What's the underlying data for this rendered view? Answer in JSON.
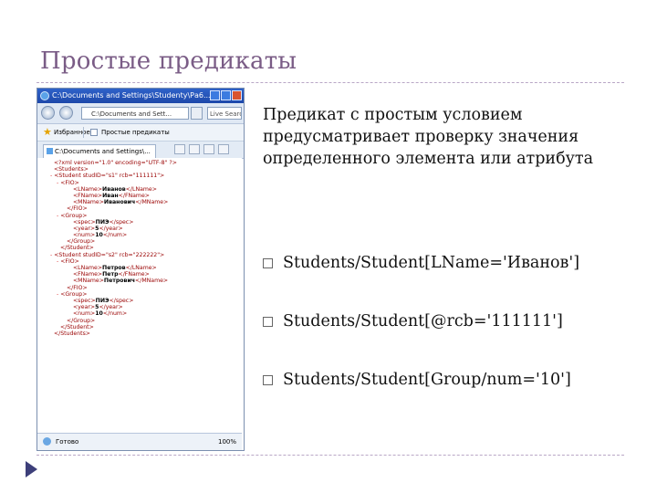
{
  "slide": {
    "title": "Простые предикаты",
    "description": "Предикат с простым условием предусматривает проверку значения определенного элемента или атрибута",
    "bullets": [
      "Students/Student[LName='Иванов']",
      "Students/Student[@rcb='111111']",
      "Students/Student[Group/num='10']"
    ]
  },
  "browser": {
    "window_title": "C:\\Documents and Settings\\Studenty\\Ра6...",
    "address": "C:\\Documents and Sett...",
    "search": "Live Search",
    "favorites_label": "Избранное",
    "favorites_page": "Простые предикаты",
    "tab_title": "C:\\Documents and Settings\\...",
    "status_text": "Готово",
    "zoom": "100%",
    "xml_lines": [
      {
        "indent": 0,
        "mark": "",
        "tag": "<?xml version=\"1.0\" encoding=\"UTF-8\" ?>",
        "text": ""
      },
      {
        "indent": 0,
        "mark": "",
        "tag": "<Students>",
        "text": ""
      },
      {
        "indent": 0,
        "mark": "- ",
        "tag": "<Student studID=\"s1\" rcb=\"111111\">",
        "text": ""
      },
      {
        "indent": 1,
        "mark": "- ",
        "tag": "<FIO>",
        "text": ""
      },
      {
        "indent": 3,
        "mark": "",
        "tag": "<LName>",
        "text": "Иванов",
        "close": "</LName>"
      },
      {
        "indent": 3,
        "mark": "",
        "tag": "<FName>",
        "text": "Иван",
        "close": "</FName>"
      },
      {
        "indent": 3,
        "mark": "",
        "tag": "<MName>",
        "text": "Иванович",
        "close": "</MName>"
      },
      {
        "indent": 2,
        "mark": "",
        "tag": "</FIO>",
        "text": ""
      },
      {
        "indent": 1,
        "mark": "- ",
        "tag": "<Group>",
        "text": ""
      },
      {
        "indent": 3,
        "mark": "",
        "tag": "<spec>",
        "text": "ПИЭ",
        "close": "</spec>"
      },
      {
        "indent": 3,
        "mark": "",
        "tag": "<year>",
        "text": "5",
        "close": "</year>"
      },
      {
        "indent": 3,
        "mark": "",
        "tag": "<num>",
        "text": "10",
        "close": "</num>"
      },
      {
        "indent": 2,
        "mark": "",
        "tag": "</Group>",
        "text": ""
      },
      {
        "indent": 1,
        "mark": "",
        "tag": "</Student>",
        "text": ""
      },
      {
        "indent": 0,
        "mark": "- ",
        "tag": "<Student studID=\"s2\" rcb=\"222222\">",
        "text": ""
      },
      {
        "indent": 1,
        "mark": "- ",
        "tag": "<FIO>",
        "text": ""
      },
      {
        "indent": 3,
        "mark": "",
        "tag": "<LName>",
        "text": "Петров",
        "close": "</LName>"
      },
      {
        "indent": 3,
        "mark": "",
        "tag": "<FName>",
        "text": "Петр",
        "close": "</FName>"
      },
      {
        "indent": 3,
        "mark": "",
        "tag": "<MName>",
        "text": "Петрович",
        "close": "</MName>"
      },
      {
        "indent": 2,
        "mark": "",
        "tag": "</FIO>",
        "text": ""
      },
      {
        "indent": 1,
        "mark": "- ",
        "tag": "<Group>",
        "text": ""
      },
      {
        "indent": 3,
        "mark": "",
        "tag": "<spec>",
        "text": "ПИЭ",
        "close": "</spec>"
      },
      {
        "indent": 3,
        "mark": "",
        "tag": "<year>",
        "text": "5",
        "close": "</year>"
      },
      {
        "indent": 3,
        "mark": "",
        "tag": "<num>",
        "text": "10",
        "close": "</num>"
      },
      {
        "indent": 2,
        "mark": "",
        "tag": "</Group>",
        "text": ""
      },
      {
        "indent": 1,
        "mark": "",
        "tag": "</Student>",
        "text": ""
      },
      {
        "indent": 0,
        "mark": "",
        "tag": "</Students>",
        "text": ""
      }
    ]
  },
  "colors": {
    "title": "#7a5c86",
    "rule": "#b9a7c6",
    "accent_arrow": "#3d3f7a"
  }
}
